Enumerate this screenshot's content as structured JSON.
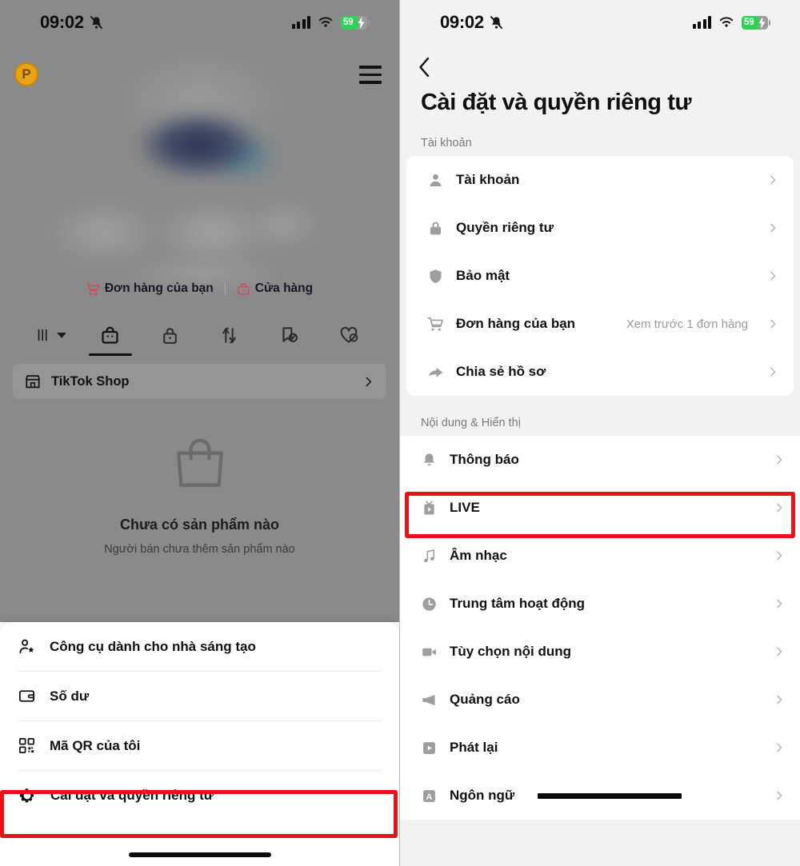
{
  "status_bar": {
    "time": "09:02",
    "mute_icon": "bell-slash-icon",
    "signal_icon": "cellular-signal-icon",
    "wifi_icon": "wifi-icon",
    "battery_percent": "59",
    "battery_charging": true,
    "battery_green": "#31d158"
  },
  "left_screen": {
    "profile_badge": "P",
    "menu_icon": "hamburger-menu-icon",
    "shop_links": [
      {
        "icon": "cart-icon",
        "label": "Đơn hàng của bạn"
      },
      {
        "icon": "shopping-bag-icon",
        "label": "Cửa hàng"
      }
    ],
    "tabs": [
      {
        "icon": "grid-dropdown-icon",
        "name": "playlist-tab",
        "selected": false
      },
      {
        "icon": "shop-bag-icon",
        "name": "shop-tab",
        "selected": true
      },
      {
        "icon": "lock-icon",
        "name": "private-tab",
        "selected": false
      },
      {
        "icon": "repost-icon",
        "name": "repost-tab",
        "selected": false
      },
      {
        "icon": "bookmark-off-icon",
        "name": "saved-tab",
        "selected": false
      },
      {
        "icon": "heart-off-icon",
        "name": "liked-tab",
        "selected": false
      }
    ],
    "tiktok_shop": {
      "icon": "storefront-icon",
      "label": "TikTok Shop",
      "chevron": "chevron-right-icon"
    },
    "empty_state": {
      "icon": "shopping-bag-outline-icon",
      "title": "Chưa có sản phẩm nào",
      "subtitle": "Người bán chưa thêm sản phẩm nào"
    },
    "sheet_items": [
      {
        "icon": "person-star-icon",
        "label": "Công cụ dành cho nhà sáng tạo",
        "highlighted": false
      },
      {
        "icon": "wallet-icon",
        "label": "Số dư",
        "highlighted": false
      },
      {
        "icon": "qr-code-icon",
        "label": "Mã QR của tôi",
        "highlighted": false
      },
      {
        "icon": "gear-icon",
        "label": "Cài đặt và quyền riêng tư",
        "highlighted": true
      }
    ],
    "highlight_color": "#e8121a"
  },
  "right_screen": {
    "back_icon": "chevron-left-icon",
    "title": "Cài đặt và quyền riêng tư",
    "sections": [
      {
        "header": "Tài khoản",
        "items": [
          {
            "icon": "person-icon",
            "label": "Tài khoản",
            "value": "",
            "highlighted": false
          },
          {
            "icon": "lock-icon",
            "label": "Quyền riêng tư",
            "value": "",
            "highlighted": false
          },
          {
            "icon": "shield-icon",
            "label": "Bảo mật",
            "value": "",
            "highlighted": false
          },
          {
            "icon": "cart-icon",
            "label": "Đơn hàng của bạn",
            "value": "Xem trước 1 đơn hàng",
            "highlighted": false
          },
          {
            "icon": "share-arrow-icon",
            "label": "Chia sẻ hồ sơ",
            "value": "",
            "highlighted": false
          }
        ]
      },
      {
        "header": "Nội dung & Hiển thị",
        "items": [
          {
            "icon": "bell-icon",
            "label": "Thông báo",
            "value": "",
            "highlighted": true
          },
          {
            "icon": "live-tv-icon",
            "label": "LIVE",
            "value": "",
            "highlighted": false
          },
          {
            "icon": "music-note-icon",
            "label": "Âm nhạc",
            "value": "",
            "highlighted": false
          },
          {
            "icon": "clock-icon",
            "label": "Trung tâm hoạt động",
            "value": "",
            "highlighted": false
          },
          {
            "icon": "video-camera-icon",
            "label": "Tùy chọn nội dung",
            "value": "",
            "highlighted": false
          },
          {
            "icon": "megaphone-icon",
            "label": "Quảng cáo",
            "value": "",
            "highlighted": false
          },
          {
            "icon": "play-box-icon",
            "label": "Phát lại",
            "value": "",
            "highlighted": false
          },
          {
            "icon": "language-a-icon",
            "label": "Ngôn ngữ",
            "value": "",
            "highlighted": false,
            "redacted": true
          }
        ]
      }
    ],
    "chevron_icon": "chevron-right-icon",
    "highlight_color": "#e8121a"
  }
}
